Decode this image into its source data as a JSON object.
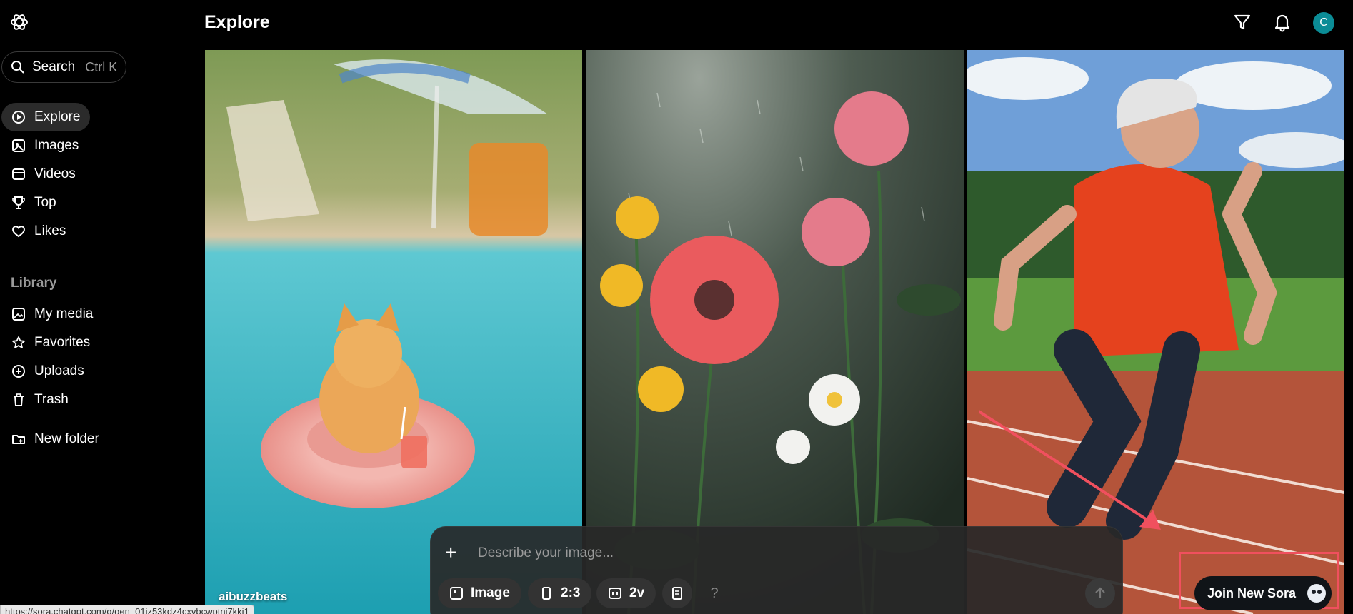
{
  "app": {
    "logo_icon": "openai-logo-icon"
  },
  "sidebar": {
    "search": {
      "label": "Search",
      "shortcut": "Ctrl K"
    },
    "nav": [
      {
        "label": "Explore",
        "icon": "compass-icon",
        "active": true
      },
      {
        "label": "Images",
        "icon": "image-icon"
      },
      {
        "label": "Videos",
        "icon": "video-icon"
      },
      {
        "label": "Top",
        "icon": "trophy-icon"
      },
      {
        "label": "Likes",
        "icon": "heart-icon"
      }
    ],
    "library_heading": "Library",
    "library": [
      {
        "label": "My media",
        "icon": "media-icon"
      },
      {
        "label": "Favorites",
        "icon": "star-icon"
      },
      {
        "label": "Uploads",
        "icon": "plus-circle-icon"
      },
      {
        "label": "Trash",
        "icon": "trash-icon"
      }
    ],
    "new_folder": {
      "label": "New folder",
      "icon": "folder-plus-icon"
    }
  },
  "header": {
    "title": "Explore",
    "avatar_letter": "C"
  },
  "feed": {
    "author": "aibuzzbeats"
  },
  "composer": {
    "placeholder": "Describe your image...",
    "type_label": "Image",
    "ratio_label": "2:3",
    "variations_label": "2v",
    "help_label": "?"
  },
  "promo": {
    "join_label": "Join New Sora"
  },
  "status_bar": {
    "url": "https://sora.chatgpt.com/g/gen_01jz53kdz4cxvbcwptni7kki1"
  },
  "colors": {
    "accent_avatar": "#0b8c96",
    "highlight": "#f0505e"
  }
}
